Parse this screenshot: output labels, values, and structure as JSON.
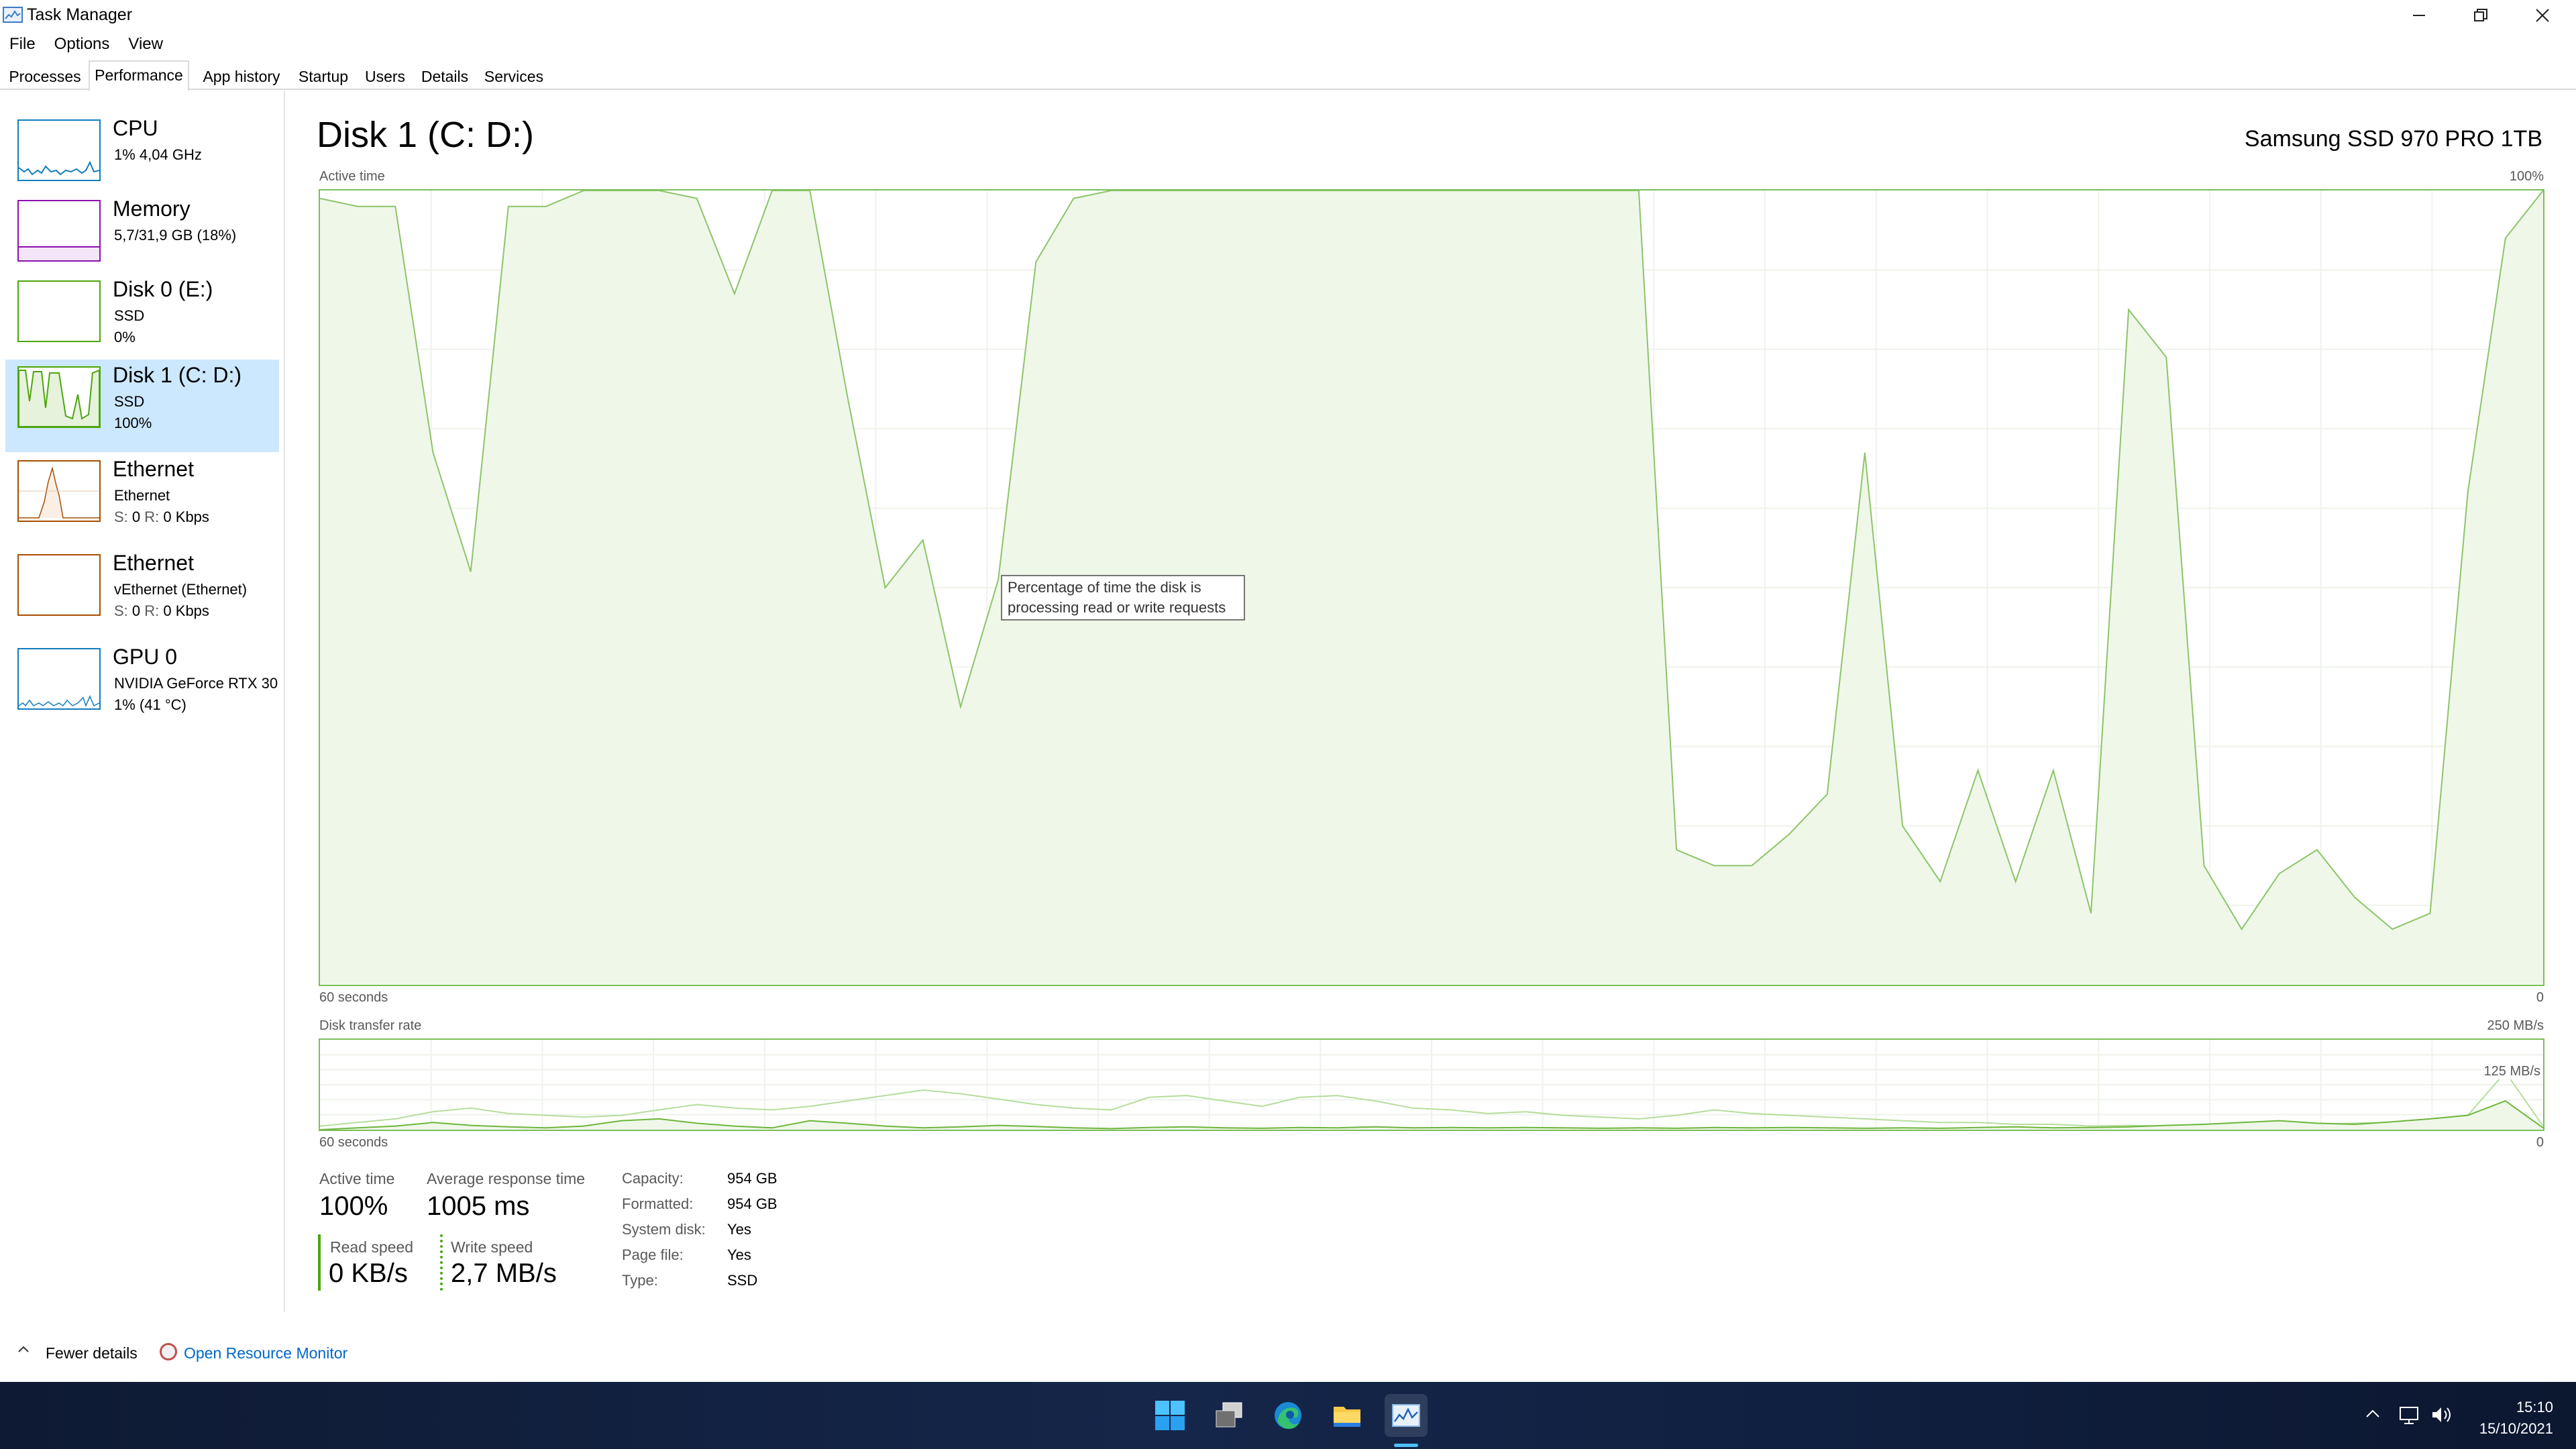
{
  "window": {
    "title": "Task Manager"
  },
  "menu": [
    "File",
    "Options",
    "View"
  ],
  "tabs": [
    "Processes",
    "Performance",
    "App history",
    "Startup",
    "Users",
    "Details",
    "Services"
  ],
  "resources": [
    {
      "name": "CPU",
      "line1": "1% 4,04 GHz",
      "line2": "",
      "color": "#117dbb"
    },
    {
      "name": "Memory",
      "line1": "5,7/31,9 GB (18%)",
      "line2": "",
      "color": "#8b12ae"
    },
    {
      "name": "Disk 0 (E:)",
      "line1": "SSD",
      "line2": "0%",
      "color": "#4da60c"
    },
    {
      "name": "Disk 1 (C: D:)",
      "line1": "SSD",
      "line2": "100%",
      "color": "#4da60c"
    },
    {
      "name": "Ethernet",
      "line1": "Ethernet",
      "line2_s": "S:",
      "line2_s_val": "0",
      "line2_r": "R:",
      "line2_r_val": "0 Kbps",
      "color": "#a74f01"
    },
    {
      "name": "Ethernet",
      "line1": "vEthernet (Ethernet)",
      "line2_s": "S:",
      "line2_s_val": "0",
      "line2_r": "R:",
      "line2_r_val": "0 Kbps",
      "color": "#a74f01"
    },
    {
      "name": "GPU 0",
      "line1": "NVIDIA GeForce RTX 30",
      "line2": "1% (41 °C)",
      "color": "#117dbb"
    }
  ],
  "main": {
    "title": "Disk 1 (C: D:)",
    "model": "Samsung SSD 970 PRO 1TB",
    "active_graph": {
      "label": "Active time",
      "max_label": "100%",
      "x_left": "60 seconds",
      "x_right": "0",
      "values": [
        99,
        98,
        98,
        67,
        52,
        98,
        98,
        100,
        100,
        100,
        99,
        87,
        100,
        100,
        74,
        50,
        56,
        35,
        51,
        91,
        99,
        100,
        100,
        100,
        100,
        100,
        100,
        100,
        100,
        100,
        100,
        100,
        100,
        100,
        100,
        100,
        17,
        15,
        15,
        19,
        24,
        67,
        20,
        13,
        27,
        13,
        27,
        9,
        85,
        79,
        15,
        7,
        14,
        17,
        11,
        7,
        9,
        62,
        94,
        100
      ]
    },
    "tooltip": "Percentage of time the disk is processing read or write requests",
    "transfer_graph": {
      "label": "Disk transfer rate",
      "max_label": "250 MB/s",
      "mid_label": "125 MB/s",
      "x_left": "60 seconds",
      "x_right": "0",
      "read_values": [
        0,
        5,
        10,
        20,
        12,
        8,
        5,
        10,
        25,
        30,
        18,
        10,
        5,
        25,
        18,
        10,
        5,
        8,
        12,
        9,
        5,
        3,
        6,
        8,
        5,
        4,
        6,
        5,
        8,
        5,
        6,
        5,
        6,
        5,
        4,
        5,
        4,
        6,
        5,
        6,
        5,
        4,
        5,
        4,
        6,
        8,
        5,
        6,
        8,
        12,
        15,
        20,
        25,
        18,
        15,
        22,
        30,
        40,
        80,
        5
      ],
      "write_values": [
        10,
        20,
        30,
        50,
        60,
        45,
        40,
        35,
        40,
        55,
        70,
        60,
        55,
        65,
        80,
        95,
        110,
        100,
        85,
        70,
        60,
        55,
        90,
        95,
        80,
        65,
        90,
        95,
        80,
        60,
        55,
        45,
        50,
        40,
        35,
        30,
        40,
        55,
        45,
        40,
        35,
        30,
        25,
        20,
        20,
        15,
        15,
        10,
        12,
        10,
        10,
        10,
        12,
        15,
        18,
        20,
        25,
        40,
        160,
        10
      ]
    },
    "stats": {
      "active_time_label": "Active time",
      "active_time_value": "100%",
      "avg_response_label": "Average response time",
      "avg_response_value": "1005 ms",
      "read_speed_label": "Read speed",
      "read_speed_value": "0 KB/s",
      "write_speed_label": "Write speed",
      "write_speed_value": "2,7 MB/s"
    },
    "props": {
      "capacity_label": "Capacity:",
      "capacity_value": "954 GB",
      "formatted_label": "Formatted:",
      "formatted_value": "954 GB",
      "system_disk_label": "System disk:",
      "system_disk_value": "Yes",
      "page_file_label": "Page file:",
      "page_file_value": "Yes",
      "type_label": "Type:",
      "type_value": "SSD"
    }
  },
  "footer": {
    "fewer_details": "Fewer details",
    "resource_monitor": "Open Resource Monitor"
  },
  "taskbar": {
    "icons": [
      "windows-start-icon",
      "task-view-icon",
      "edge-icon",
      "file-explorer-icon",
      "task-manager-icon"
    ],
    "time": "15:10",
    "date": "15/10/2021"
  },
  "colors": {
    "disk_green": "#4da60c",
    "disk_fill": "#eff7e9",
    "selected_bg": "#cce8ff",
    "link": "#0066cc"
  }
}
